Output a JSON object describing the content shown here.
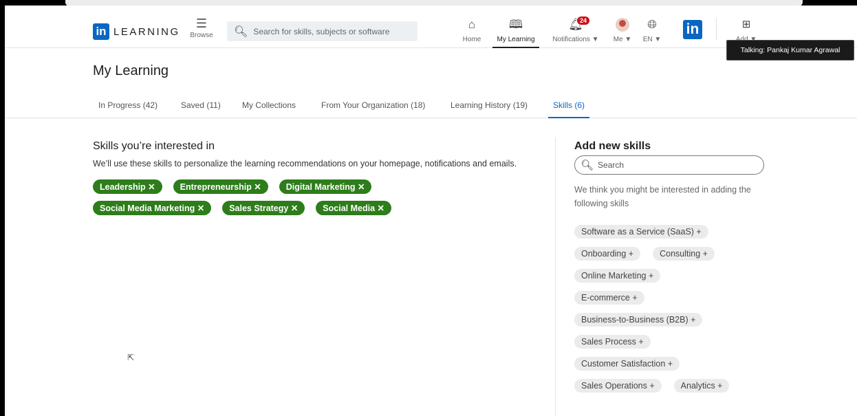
{
  "header": {
    "logo_word": "LEARNING",
    "logo_in": "in",
    "browse_label": "Browse",
    "search_placeholder": "Search for skills, subjects or software",
    "nav": {
      "home": "Home",
      "my_learning": "My Learning",
      "notifications": "Notifications ▼",
      "notifications_count": "24",
      "me": "Me ▼",
      "language": "EN ▼",
      "add": "Add ▼"
    },
    "linkedin_in": "in"
  },
  "tooltip": "Talking: Pankaj Kumar Agrawal",
  "page_title": "My Learning",
  "tabs": [
    {
      "label": "In Progress (42)"
    },
    {
      "label": "Saved (11)"
    },
    {
      "label": "My Collections"
    },
    {
      "label": "From Your Organization (18)"
    },
    {
      "label": "Learning History (19)"
    },
    {
      "label": "Skills (6)",
      "active": true
    }
  ],
  "interested": {
    "heading": "Skills you’re interested in",
    "description": "We’ll use these skills to personalize the learning recommendations on your homepage, notifications and emails.",
    "skills": [
      "Leadership ✕",
      "Entrepreneurship ✕",
      "Digital Marketing ✕",
      "Social Media Marketing ✕",
      "Sales Strategy ✕",
      "Social Media ✕"
    ]
  },
  "add_new": {
    "heading": "Add new skills",
    "search_placeholder": "Search",
    "suggestion_text": "We think you might be interested in adding the following skills",
    "suggestions": [
      "Software as a Service (SaaS) +",
      "Onboarding +",
      "Consulting +",
      "Online Marketing +",
      "E-commerce +",
      "Business-to-Business (B2B) +",
      "Sales Process +",
      "Customer Satisfaction +",
      "Sales Operations +",
      "Analytics +"
    ]
  },
  "colors": {
    "brand_blue": "#0a66c2",
    "skill_green": "#2e7d1b",
    "badge_red": "#cc1016"
  },
  "icons": [
    "menu-icon",
    "search-icon",
    "home-icon",
    "book-icon",
    "bell-icon",
    "globe-icon",
    "plus-box-icon",
    "cursor-icon"
  ]
}
